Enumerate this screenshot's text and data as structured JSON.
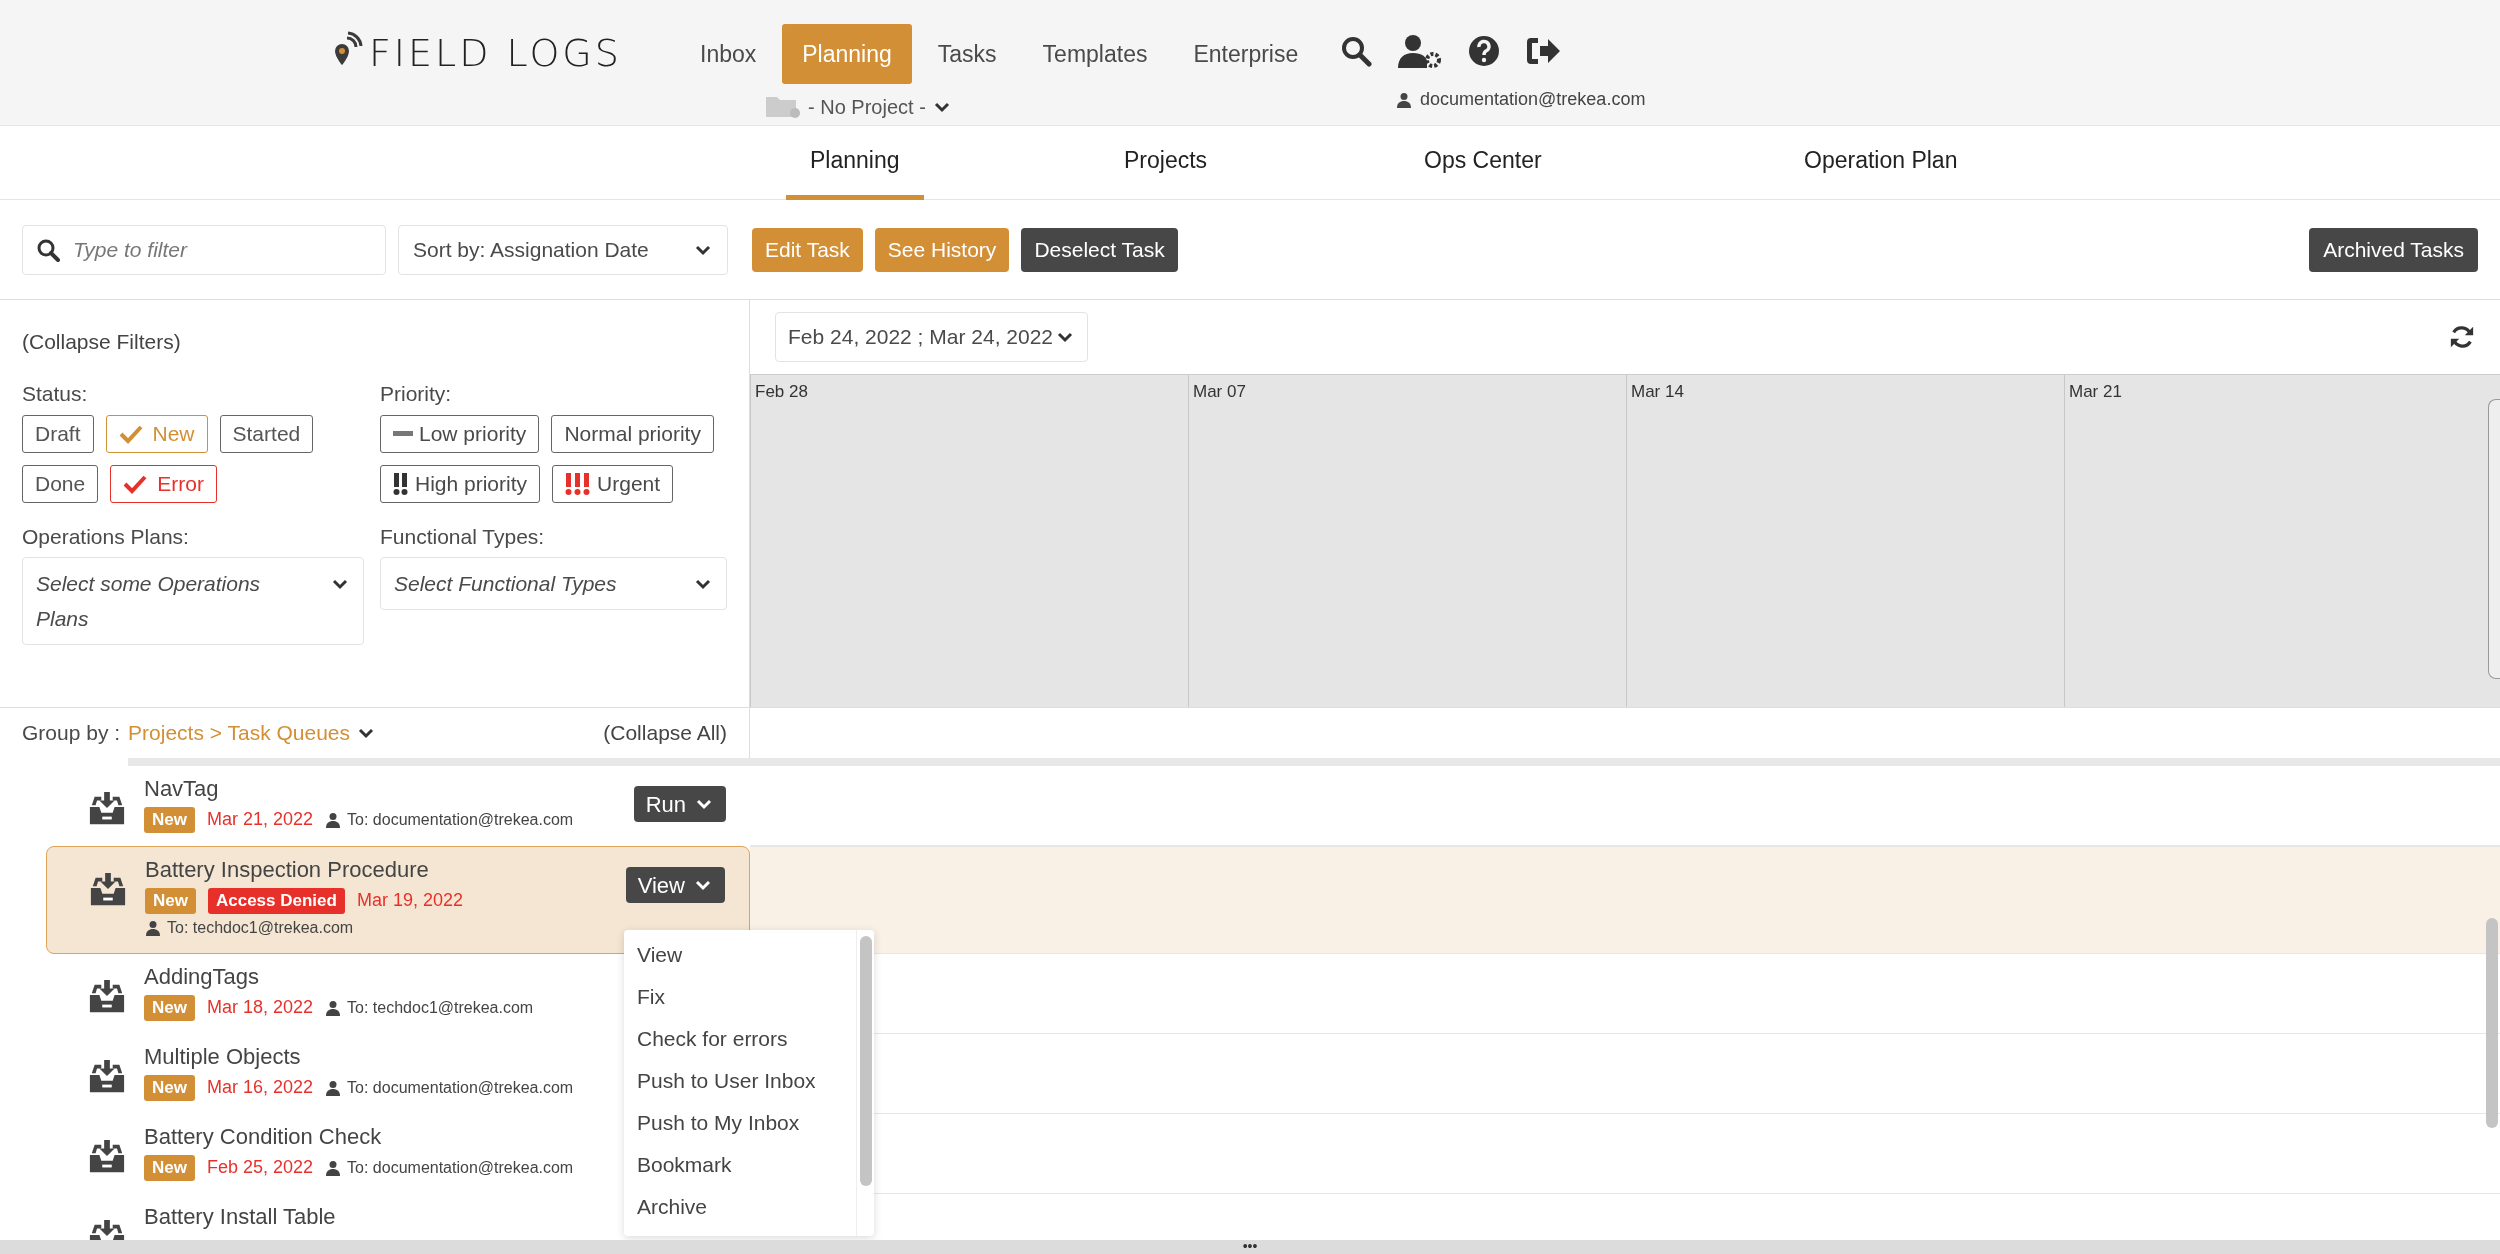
{
  "header": {
    "logo": "FIELD LOGS",
    "project_selector": "- No Project -",
    "user_email": "documentation@trekea.com"
  },
  "nav": [
    {
      "label": "Inbox",
      "selected": false
    },
    {
      "label": "Planning",
      "selected": true
    },
    {
      "label": "Tasks",
      "selected": false
    },
    {
      "label": "Templates",
      "selected": false
    },
    {
      "label": "Enterprise",
      "selected": false
    }
  ],
  "subtabs": [
    {
      "label": "Planning",
      "selected": true
    },
    {
      "label": "Projects",
      "selected": false
    },
    {
      "label": "Ops Center",
      "selected": false
    },
    {
      "label": "Operation Plan",
      "selected": false
    }
  ],
  "toolbar": {
    "filter": {
      "placeholder": "Type to filter"
    },
    "sort": "Sort by: Assignation Date",
    "buttons": [
      {
        "label": "Edit Task",
        "kind": "primary"
      },
      {
        "label": "See History",
        "kind": "primary"
      },
      {
        "label": "Deselect Task",
        "kind": "dark"
      }
    ],
    "archived": "Archived Tasks"
  },
  "filters": {
    "collapse": "(Collapse Filters)",
    "status_label": "Status:",
    "statuses": [
      {
        "label": "Draft",
        "checked": false,
        "color": "#555555"
      },
      {
        "label": "New",
        "checked": true,
        "color": "#d38f35"
      },
      {
        "label": "Started",
        "checked": false,
        "color": "#555555"
      },
      {
        "label": "Done",
        "checked": false,
        "color": "#555555"
      },
      {
        "label": "Error",
        "checked": true,
        "color": "#e8302a"
      }
    ],
    "priority_label": "Priority:",
    "priorities": [
      {
        "label": "Low priority",
        "kind": "low"
      },
      {
        "label": "Normal priority",
        "kind": "normal"
      },
      {
        "label": "High priority",
        "kind": "high"
      },
      {
        "label": "Urgent",
        "kind": "urgent"
      }
    ],
    "ops_plans": {
      "label": "Operations Plans:",
      "placeholder": "Select some Operations Plans"
    },
    "functional_types": {
      "label": "Functional Types:",
      "placeholder": "Select Functional Types"
    }
  },
  "timeline": {
    "range": "Feb 24, 2022 ; Mar 24, 2022",
    "ticks": [
      "Feb 28",
      "Mar 07",
      "Mar 14",
      "Mar 21"
    ]
  },
  "list": {
    "group_by_label": "Group by :",
    "group_by_value": "Projects > Task Queues",
    "collapse_all": "(Collapse All)",
    "tasks": [
      {
        "title": "NavTag",
        "badges": [
          {
            "label": "New",
            "kind": "status"
          }
        ],
        "date": "Mar 21, 2022",
        "assignee": "To: documentation@trekea.com",
        "action": "Run",
        "selected": false
      },
      {
        "title": "Battery Inspection Procedure",
        "badges": [
          {
            "label": "New",
            "kind": "status"
          },
          {
            "label": "Access Denied",
            "kind": "error"
          }
        ],
        "date": "Mar 19, 2022",
        "assignee": "To: techdoc1@trekea.com",
        "action": "View",
        "selected": true
      },
      {
        "title": "AddingTags",
        "badges": [
          {
            "label": "New",
            "kind": "status"
          }
        ],
        "date": "Mar 18, 2022",
        "assignee": "To: techdoc1@trekea.com",
        "selected": false
      },
      {
        "title": "Multiple Objects",
        "badges": [
          {
            "label": "New",
            "kind": "status"
          }
        ],
        "date": "Mar 16, 2022",
        "assignee": "To: documentation@trekea.com",
        "selected": false
      },
      {
        "title": "Battery Condition Check",
        "badges": [
          {
            "label": "New",
            "kind": "status"
          }
        ],
        "date": "Feb 25, 2022",
        "assignee": "To: documentation@trekea.com",
        "selected": false
      },
      {
        "title": "Battery Install Table",
        "selected": false
      }
    ]
  },
  "menu": {
    "items": [
      "View",
      "Fix",
      "Check for errors",
      "Push to User Inbox",
      "Push to My Inbox",
      "Bookmark",
      "Archive"
    ]
  },
  "bottom_handle": "•••"
}
